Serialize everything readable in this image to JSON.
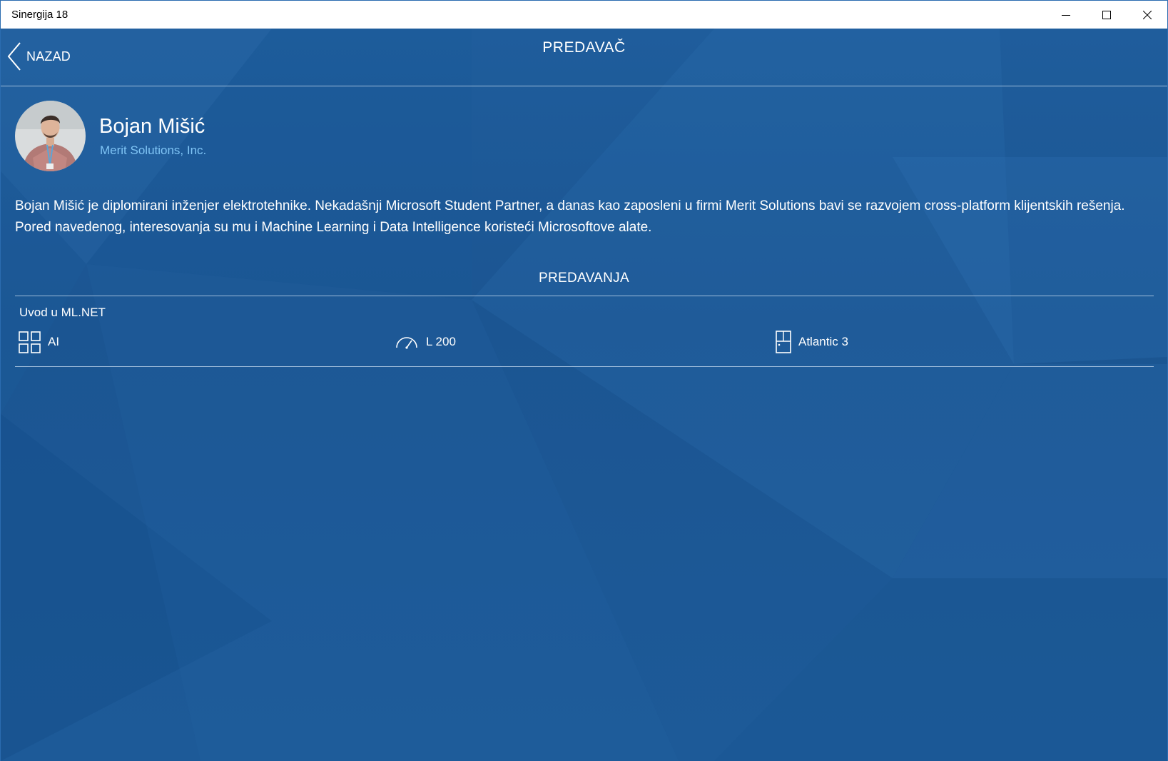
{
  "window": {
    "title": "Sinergija 18"
  },
  "header": {
    "back_label": "NAZAD",
    "title": "PREDAVAČ"
  },
  "speaker": {
    "name": "Bojan Mišić",
    "company": "Merit Solutions, Inc.",
    "bio": "Bojan Mišić je diplomirani inženjer elektrotehnike. Nekadašnji Microsoft Student Partner, a danas kao zaposleni u firmi Merit Solutions bavi se razvojem cross-platform klijentskih rešenja. Pored navedenog, interesovanja su mu i Machine Learning i Data Intelligence koristeći Microsoftove alate."
  },
  "sessions_section": {
    "title": "PREDAVANJA",
    "items": [
      {
        "title": "Uvod u ML.NET",
        "track": "AI",
        "track_icon": "grid-icon",
        "level": "L 200",
        "level_icon": "speedometer-icon",
        "room": "Atlantic 3",
        "room_icon": "door-icon"
      }
    ]
  },
  "colors": {
    "background": "#1b5592",
    "company_accent": "#7fc4f5",
    "divider": "#c8dcf0",
    "text": "#ffffff"
  }
}
